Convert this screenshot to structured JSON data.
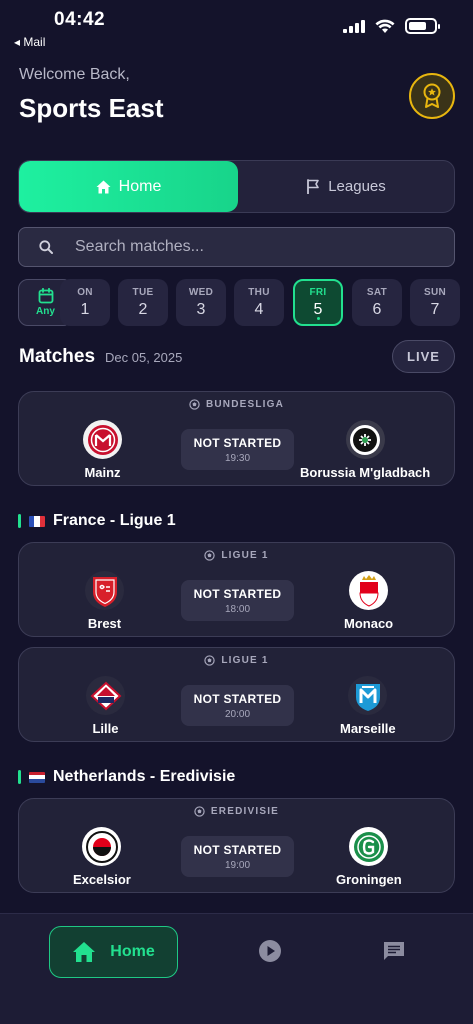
{
  "status_bar": {
    "time": "04:42",
    "back_label": "◂ Mail"
  },
  "header": {
    "welcome": "Welcome Back,",
    "title": "Sports East"
  },
  "segment": {
    "home_label": "Home",
    "leagues_label": "Leagues",
    "selected": "Home"
  },
  "search": {
    "placeholder": "Search matches..."
  },
  "date_strip": {
    "any_label": "Any",
    "days": [
      {
        "name": "ON",
        "num": "1"
      },
      {
        "name": "TUE",
        "num": "2"
      },
      {
        "name": "WED",
        "num": "3"
      },
      {
        "name": "THU",
        "num": "4"
      },
      {
        "name": "FRI",
        "num": "5",
        "selected": true
      },
      {
        "name": "SAT",
        "num": "6"
      },
      {
        "name": "SUN",
        "num": "7"
      }
    ]
  },
  "matches": {
    "title": "Matches",
    "date": "Dec 05, 2025",
    "live_label": "LIVE"
  },
  "sections": {
    "france": {
      "title": "France - Ligue 1"
    },
    "netherlands": {
      "title": "Netherlands - Eredivisie"
    }
  },
  "cards": [
    {
      "league": "BUNDESLIGA",
      "home": "Mainz",
      "away": "Borussia M'gladbach",
      "status": "NOT STARTED",
      "time": "19:30"
    },
    {
      "league": "LIGUE 1",
      "home": "Brest",
      "away": "Monaco",
      "status": "NOT STARTED",
      "time": "18:00"
    },
    {
      "league": "LIGUE 1",
      "home": "Lille",
      "away": "Marseille",
      "status": "NOT STARTED",
      "time": "20:00"
    },
    {
      "league": "EREDIVISIE",
      "home": "Excelsior",
      "away": "Groningen",
      "status": "NOT STARTED",
      "time": "19:00"
    }
  ],
  "bottom_nav": {
    "home_label": "Home",
    "items": [
      "home-icon",
      "play-icon",
      "chat-icon"
    ]
  },
  "colors": {
    "accent": "#22e08f",
    "background": "#14132b",
    "card": "#222238",
    "award": "#e8b60f"
  }
}
